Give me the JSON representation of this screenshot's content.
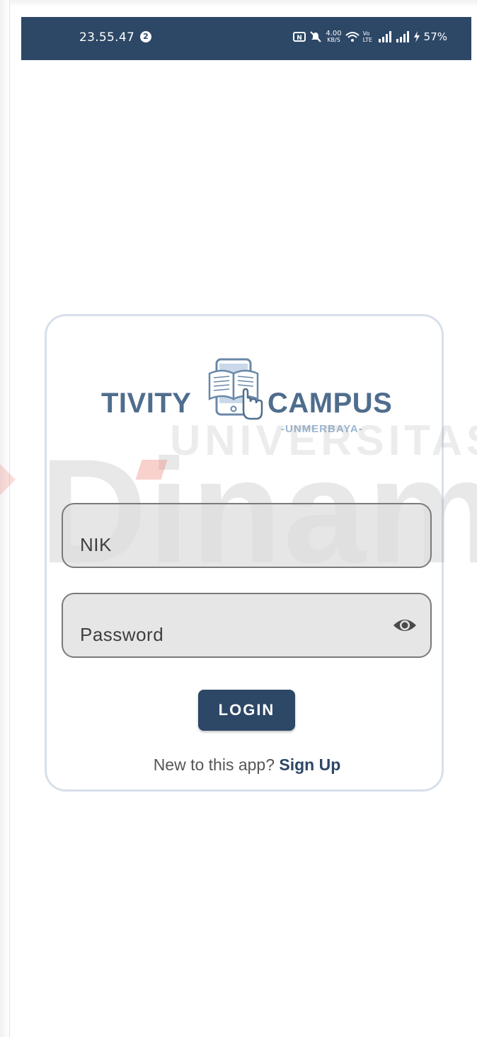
{
  "status_bar": {
    "time": "23.55.47",
    "notification_badge": "2",
    "network_speed_value": "4.00",
    "network_speed_unit": "KB/S",
    "volte_label": "Vo LTE",
    "battery": "57%"
  },
  "logo": {
    "left_text": "TIVITY",
    "right_text": "CAMPUS",
    "subtitle": "-UNMERBAYA-"
  },
  "watermark": {
    "line1": "UNIVERSITAS",
    "line2": "Dinam"
  },
  "form": {
    "nik_label": "NIK",
    "password_label": "Password",
    "login_label": "LOGIN",
    "signup_prompt": "New to this app? ",
    "signup_link": "Sign Up"
  },
  "colors": {
    "primary": "#2d4766",
    "logo": "#4f6d8d",
    "logo_sub": "#9cb8d2",
    "card_border": "#d7e0ea"
  },
  "icons": {
    "notification": "notification-badge-icon",
    "status": [
      "nfc-icon",
      "mute-icon",
      "wifi-icon",
      "signal-icon",
      "signal-icon",
      "charging-icon"
    ],
    "password_toggle": "eye-icon"
  }
}
